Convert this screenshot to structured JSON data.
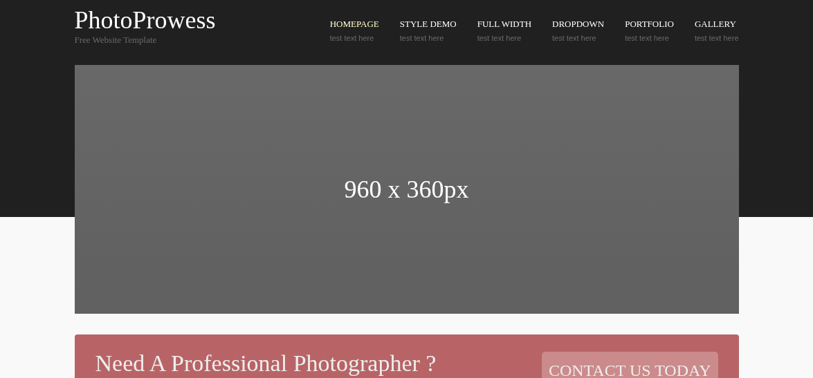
{
  "site": {
    "title": "PhotoProwess",
    "tagline": "Free Website Template"
  },
  "nav": [
    {
      "label": "HOMEPAGE",
      "sub": "test text here",
      "selected": true
    },
    {
      "label": "STYLE DEMO",
      "sub": "test text here",
      "selected": false
    },
    {
      "label": "FULL WIDTH",
      "sub": "test text here",
      "selected": false
    },
    {
      "label": "DROPDOWN",
      "sub": "test text here",
      "selected": false
    },
    {
      "label": "PORTFOLIO",
      "sub": "test text here",
      "selected": false
    },
    {
      "label": "GALLERY",
      "sub": "test text here",
      "selected": false
    }
  ],
  "banner": {
    "text": "960 x 360px"
  },
  "callout": {
    "heading": "Need A Professional Photographer ?",
    "button": "CONTACT US TODAY"
  }
}
